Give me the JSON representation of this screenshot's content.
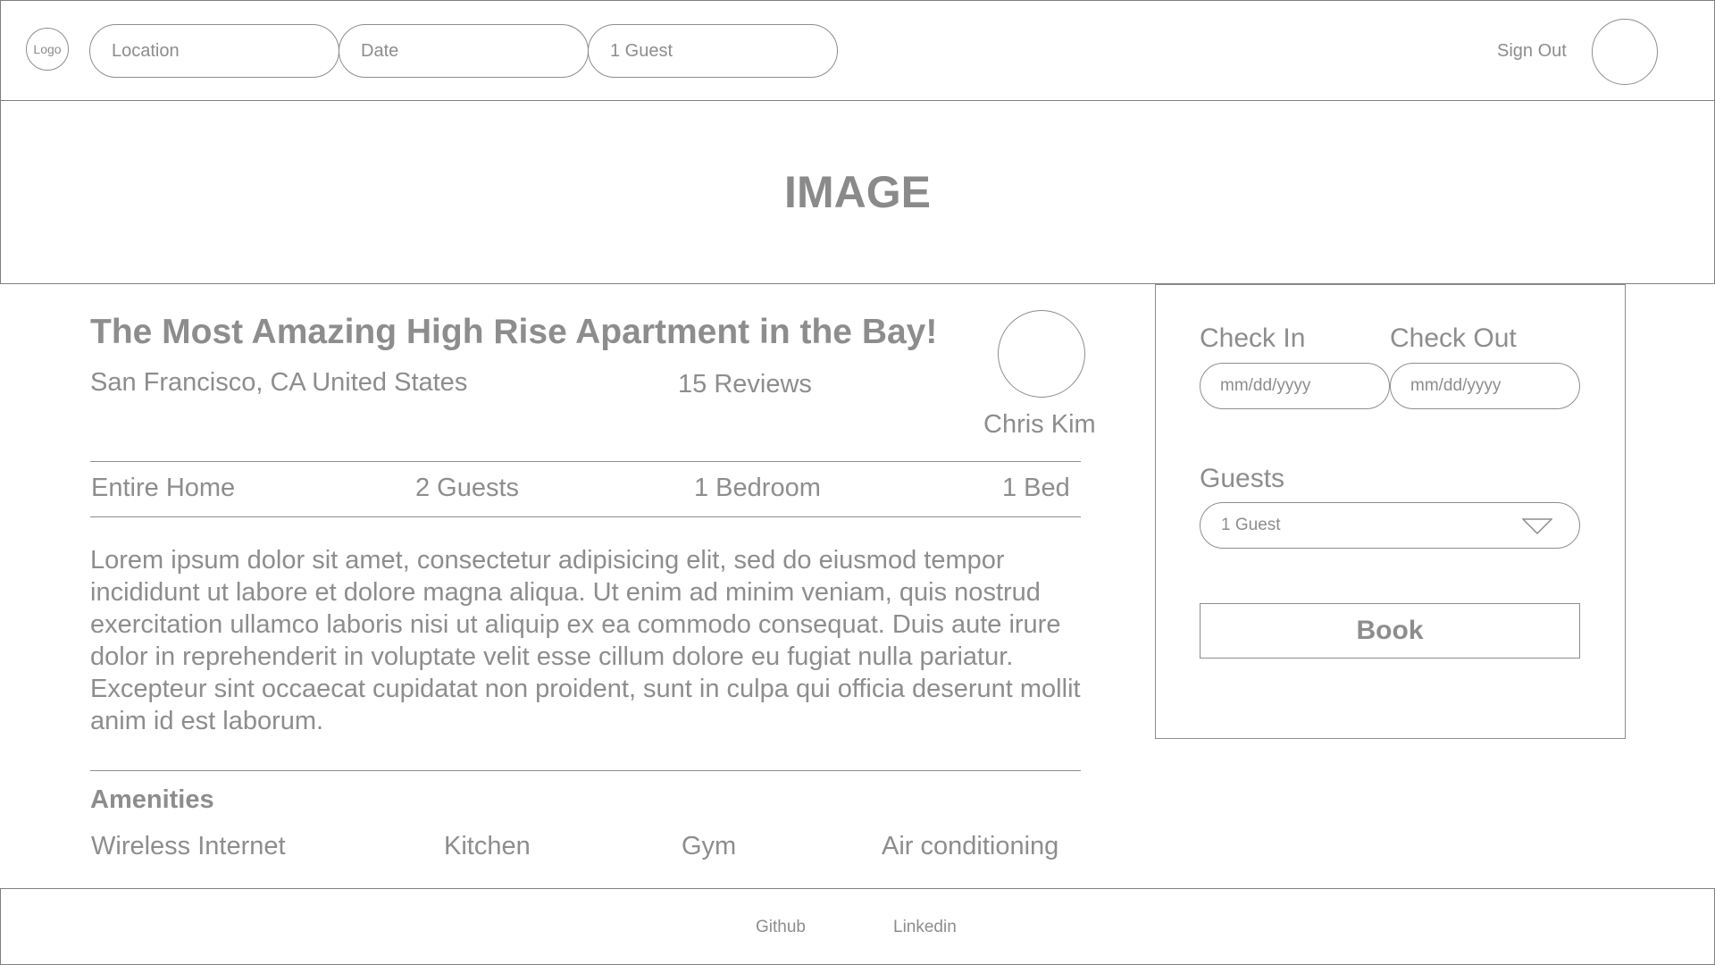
{
  "header": {
    "logo": "Logo",
    "search": {
      "location": "Location",
      "date": "Date",
      "guests": "1 Guest"
    },
    "sign_out": "Sign Out"
  },
  "banner": {
    "text": "IMAGE"
  },
  "listing": {
    "title": "The Most Amazing High Rise Apartment in the Bay!",
    "location": "San Francisco, CA United States",
    "reviews": "15 Reviews",
    "host": "Chris Kim",
    "features": [
      "Entire Home",
      "2 Guests",
      "1 Bedroom",
      "1 Bed"
    ],
    "description": "Lorem ipsum dolor sit amet, consectetur adipisicing elit, sed do eiusmod tempor incididunt ut labore et dolore magna aliqua. Ut enim ad minim veniam, quis nostrud exercitation ullamco laboris nisi ut aliquip ex ea commodo consequat. Duis aute irure dolor in reprehenderit in voluptate velit esse cillum dolore eu fugiat nulla pariatur. Excepteur sint occaecat cupidatat non proident, sunt in culpa qui officia deserunt mollit anim id est laborum.",
    "amenities_title": "Amenities",
    "amenities": [
      "Wireless Internet",
      "Kitchen",
      "Gym",
      "Air conditioning"
    ]
  },
  "booking": {
    "check_in_label": "Check In",
    "check_out_label": "Check Out",
    "check_in_placeholder": "mm/dd/yyyy",
    "check_out_placeholder": "mm/dd/yyyy",
    "guests_label": "Guests",
    "guests_value": "1 Guest",
    "book_label": "Book"
  },
  "footer": {
    "links": [
      "Github",
      "Linkedin"
    ]
  },
  "colors": {
    "stroke": "#8d8d8d",
    "text": "#8d8d8d",
    "background": "#ffffff"
  }
}
